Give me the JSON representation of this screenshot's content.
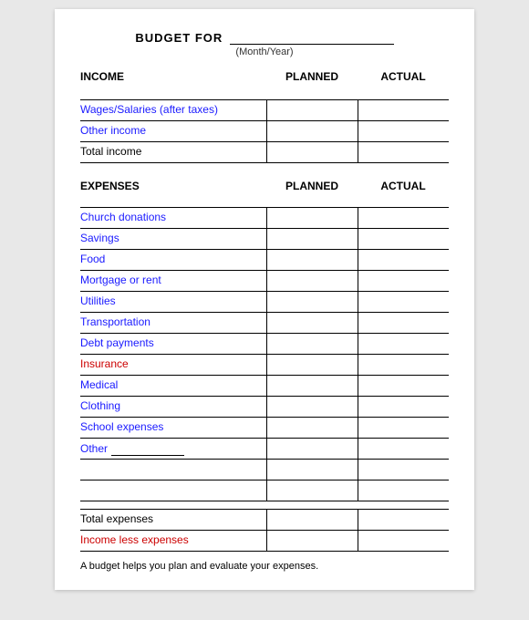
{
  "title": {
    "budget_for": "BUDGET FOR",
    "month_year_label": "(Month/Year)"
  },
  "income": {
    "section_title": "INCOME",
    "planned_header": "PLANNED",
    "actual_header": "ACTUAL",
    "rows": [
      {
        "label": "Wages/Salaries (after taxes)",
        "color": "blue"
      },
      {
        "label": "Other income",
        "color": "blue"
      },
      {
        "label": "Total income",
        "color": "black"
      }
    ]
  },
  "expenses": {
    "section_title": "EXPENSES",
    "planned_header": "PLANNED",
    "actual_header": "ACTUAL",
    "rows": [
      {
        "label": "Church donations",
        "color": "blue"
      },
      {
        "label": "Savings",
        "color": "blue"
      },
      {
        "label": "Food",
        "color": "blue"
      },
      {
        "label": "Mortgage or rent",
        "color": "blue"
      },
      {
        "label": "Utilities",
        "color": "blue"
      },
      {
        "label": "Transportation",
        "color": "blue"
      },
      {
        "label": "Debt payments",
        "color": "blue"
      },
      {
        "label": "Insurance",
        "color": "red"
      },
      {
        "label": "Medical",
        "color": "blue"
      },
      {
        "label": "Clothing",
        "color": "blue"
      },
      {
        "label": "School expenses",
        "color": "blue"
      },
      {
        "label": "Other",
        "color": "blue",
        "has_underline": true
      }
    ],
    "blank_rows": 2,
    "totals": [
      {
        "label": "Total expenses",
        "color": "black"
      },
      {
        "label": "Income less expenses",
        "color": "red"
      }
    ]
  },
  "footer": {
    "text": "A budget helps you plan and evaluate your expenses."
  }
}
